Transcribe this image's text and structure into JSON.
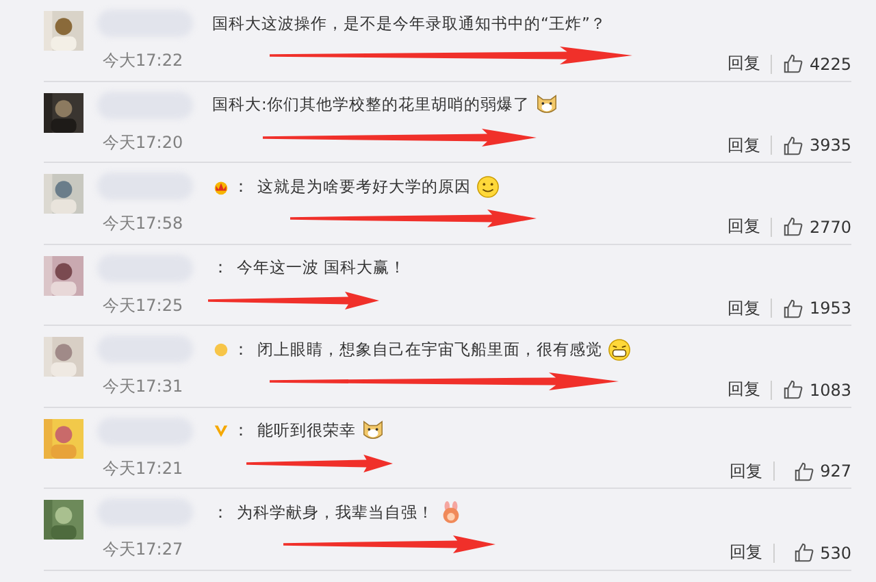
{
  "comments": [
    {
      "text": "国科大这波操作，是不是今年录取通知书中的“王炸”？",
      "time": "今大17:22",
      "reply": "回复",
      "likes": "4225"
    },
    {
      "text": "国科大:你们其他学校整的花里胡哨的弱爆了",
      "emoji": {
        "kind": "doge"
      },
      "time": "今天17:20",
      "reply": "回复",
      "likes": "3935"
    },
    {
      "badge": {
        "kind": "crown"
      },
      "separator": "：",
      "text": "这就是为啥要考好大学的原因",
      "emoji": {
        "kind": "smile"
      },
      "time": "今天17:58",
      "reply": "回复",
      "likes": "2770"
    },
    {
      "separator": "：",
      "text": "今年这一波 国科大赢！",
      "time": "今天17:25",
      "reply": "回复",
      "likes": "1953"
    },
    {
      "badge": {
        "kind": "member"
      },
      "separator": "：",
      "text": "闭上眼睛，想象自己在宇宙飞船里面，很有感觉",
      "emoji": {
        "kind": "grin"
      },
      "time": "今天17:31",
      "reply": "回复",
      "likes": "1083"
    },
    {
      "badge": {
        "kind": "vip"
      },
      "separator": "：",
      "text": "能听到很荣幸",
      "emoji": {
        "kind": "doge"
      },
      "time": "今天17:21",
      "reply": "回复",
      "likes": "927"
    },
    {
      "separator": "：",
      "text": "为科学献身，我辈当自强！",
      "emoji": {
        "kind": "bunny"
      },
      "time": "今天17:27",
      "reply": "回复",
      "likes": "530"
    }
  ]
}
